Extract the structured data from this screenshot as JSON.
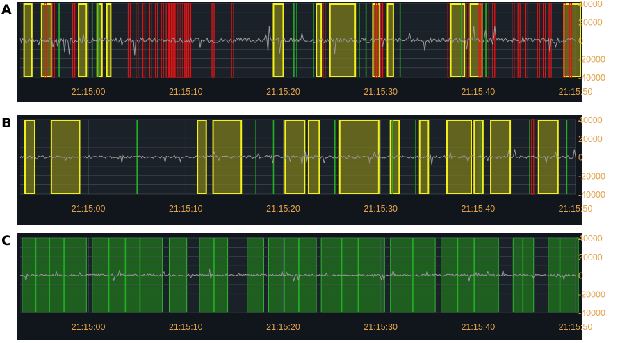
{
  "panels": [
    {
      "letter": "A"
    },
    {
      "letter": "B"
    },
    {
      "letter": "C"
    }
  ],
  "colors": {
    "background": "#11161d",
    "plot": "#1b2129",
    "grid": "#4a535e",
    "tick_text": "#e3a24a",
    "waveform": "#9a9a9a",
    "yellow": "#f3f01a",
    "yellow_fill": "#7c7a1d",
    "red": "#e01414",
    "green": "#1f9a1f",
    "green_fill": "#1f6a1f"
  },
  "chart_data": [
    {
      "type": "line",
      "panel": "A",
      "title": "",
      "xlabel": "",
      "ylabel": "",
      "xlim": [
        "21:14:53",
        "21:15:50"
      ],
      "ylim": [
        -40000,
        40000
      ],
      "xticks": [
        "21:15:00",
        "21:15:10",
        "21:15:20",
        "21:15:30",
        "21:15:40",
        "21:15:50"
      ],
      "yticks": [
        "40000",
        "20000",
        "0",
        "-20000",
        "-40000"
      ],
      "grid": true,
      "waveform_amplitude": 15000,
      "yellow_intervals": [
        [
          "21:14:53.4",
          "21:14:54.2"
        ],
        [
          "21:14:55.2",
          "21:14:56.2"
        ],
        [
          "21:14:59.0",
          "21:14:59.8"
        ],
        [
          "21:15:00.9",
          "21:15:01.4"
        ],
        [
          "21:15:01.9",
          "21:15:02.3"
        ],
        [
          "21:15:19.0",
          "21:15:20.0"
        ],
        [
          "21:15:23.4",
          "21:15:23.9"
        ],
        [
          "21:15:24.8",
          "21:15:27.4"
        ],
        [
          "21:15:29.2",
          "21:15:29.9"
        ],
        [
          "21:15:30.7",
          "21:15:31.3"
        ],
        [
          "21:15:37.2",
          "21:15:38.6"
        ],
        [
          "21:15:39.2",
          "21:15:40.4"
        ],
        [
          "21:15:48.8",
          "21:15:50.5"
        ]
      ],
      "red_lines": [
        "21:14:55.6",
        "21:14:56.4",
        "21:14:58.5",
        "21:15:04.2",
        "21:15:05.0",
        "21:15:05.7",
        "21:15:06.4",
        "21:15:07.0",
        "21:15:07.6",
        "21:15:08.1",
        "21:15:08.4",
        "21:15:08.6",
        "21:15:08.8",
        "21:15:09.0",
        "21:15:09.2",
        "21:15:09.4",
        "21:15:09.6",
        "21:15:09.8",
        "21:15:10.0",
        "21:15:10.2",
        "21:15:10.4",
        "21:15:12.8",
        "21:15:14.8",
        "21:15:24.2",
        "21:15:29.6",
        "21:15:30.1",
        "21:15:37.0",
        "21:15:38.9",
        "21:15:40.2",
        "21:15:41.0",
        "21:15:41.6",
        "21:15:43.6",
        "21:15:44.2",
        "21:15:45.0",
        "21:15:46.2",
        "21:15:46.8",
        "21:15:47.4",
        "21:15:48.9",
        "21:15:49.5"
      ],
      "green_lines": [
        "21:14:57.0",
        "21:15:00.4",
        "21:15:01.0",
        "21:15:21.1",
        "21:15:21.4",
        "21:15:23.1",
        "21:15:27.8",
        "21:15:28.5",
        "21:15:32.0",
        "21:15:38.3",
        "21:15:40.8"
      ]
    },
    {
      "type": "line",
      "panel": "B",
      "title": "",
      "xlabel": "",
      "ylabel": "",
      "xlim": [
        "21:14:53",
        "21:15:50"
      ],
      "ylim": [
        -40000,
        40000
      ],
      "xticks": [
        "21:15:00",
        "21:15:10",
        "21:15:20",
        "21:15:30",
        "21:15:40",
        "21:15:50"
      ],
      "yticks": [
        "40000",
        "20000",
        "0",
        "-20000",
        "-40000"
      ],
      "grid": true,
      "waveform_amplitude": 8000,
      "yellow_intervals": [
        [
          "21:14:53.5",
          "21:14:54.5"
        ],
        [
          "21:14:56.2",
          "21:14:59.1"
        ],
        [
          "21:15:11.2",
          "21:15:12.1"
        ],
        [
          "21:15:12.8",
          "21:15:15.7"
        ],
        [
          "21:15:20.2",
          "21:15:22.2"
        ],
        [
          "21:15:22.6",
          "21:15:23.7"
        ],
        [
          "21:15:25.8",
          "21:15:29.8"
        ],
        [
          "21:15:31.0",
          "21:15:31.9"
        ],
        [
          "21:15:34.0",
          "21:15:34.9"
        ],
        [
          "21:15:36.8",
          "21:15:39.3"
        ],
        [
          "21:15:39.6",
          "21:15:40.5"
        ],
        [
          "21:15:41.3",
          "21:15:43.3"
        ],
        [
          "21:15:46.2",
          "21:15:48.2"
        ]
      ],
      "red_lines": [
        "21:15:45.6"
      ],
      "green_lines": [
        "21:15:05.0",
        "21:15:17.2",
        "21:15:19.0",
        "21:15:25.3",
        "21:15:31.2",
        "21:15:33.6",
        "21:15:40.2",
        "21:15:45.3",
        "21:15:49.1"
      ]
    },
    {
      "type": "line",
      "panel": "C",
      "title": "",
      "xlabel": "",
      "ylabel": "",
      "xlim": [
        "21:14:53",
        "21:15:50"
      ],
      "ylim": [
        -40000,
        40000
      ],
      "xticks": [
        "21:15:00",
        "21:15:10",
        "21:15:20",
        "21:15:30",
        "21:15:40",
        "21:15:50"
      ],
      "yticks": [
        "40000",
        "20000",
        "0",
        "-20000",
        "-40000"
      ],
      "grid": true,
      "waveform_amplitude": 6000,
      "green_intervals": [
        [
          "21:14:53.2",
          "21:14:59.8"
        ],
        [
          "21:15:00.4",
          "21:15:07.6"
        ],
        [
          "21:15:08.3",
          "21:15:10.1"
        ],
        [
          "21:15:11.4",
          "21:15:14.3"
        ],
        [
          "21:15:16.3",
          "21:15:18.0"
        ],
        [
          "21:15:18.5",
          "21:15:23.4"
        ],
        [
          "21:15:23.9",
          "21:15:30.4"
        ],
        [
          "21:15:31.0",
          "21:15:35.6"
        ],
        [
          "21:15:36.2",
          "21:15:42.1"
        ],
        [
          "21:15:43.6",
          "21:15:45.7"
        ],
        [
          "21:15:47.2",
          "21:15:50.3"
        ]
      ],
      "green_lines": [
        "21:14:54.6",
        "21:14:56.0",
        "21:14:57.5",
        "21:15:02.1",
        "21:15:03.8",
        "21:15:05.3",
        "21:15:12.9",
        "21:15:20.1",
        "21:15:21.6",
        "21:15:26.0",
        "21:15:27.7",
        "21:15:33.3",
        "21:15:37.9",
        "21:15:39.6",
        "21:15:44.6",
        "21:15:48.4"
      ]
    }
  ]
}
